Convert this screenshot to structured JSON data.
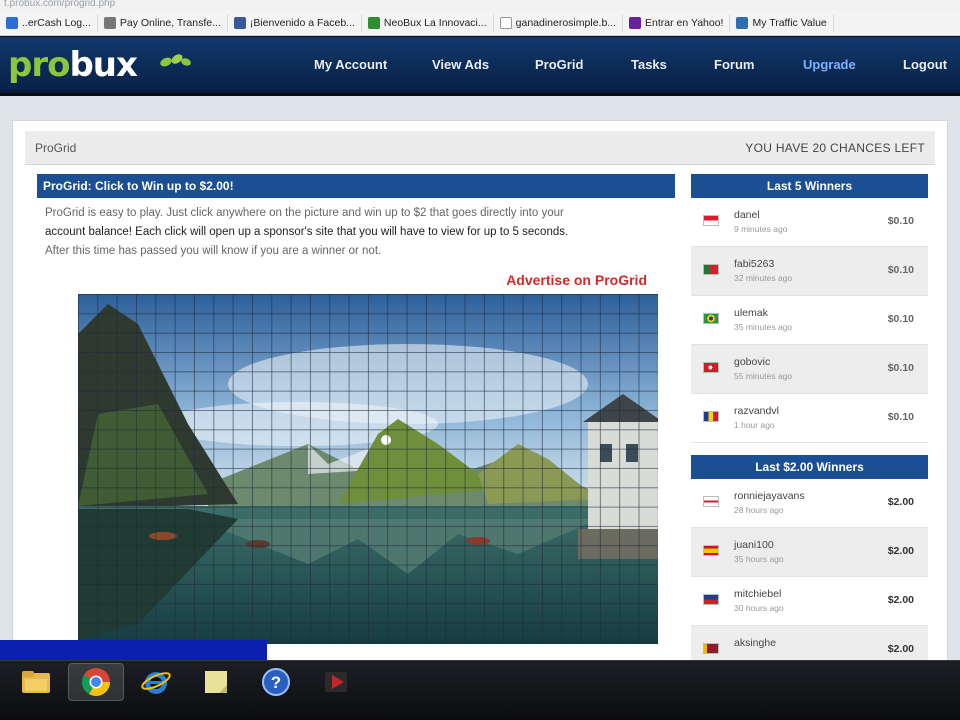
{
  "browser": {
    "address": "t.probux.com/progrid.php",
    "bookmarks": [
      {
        "label": "..erCash Log...",
        "icon": "paycash-icon",
        "color": "#2a6fd6"
      },
      {
        "label": "Pay Online, Transfe...",
        "icon": "pay-online-icon",
        "color": "#5a5a5a"
      },
      {
        "label": "¡Bienvenido a Faceb...",
        "icon": "facebook-icon",
        "color": "#3b5998"
      },
      {
        "label": "NeoBux La Innovaci...",
        "icon": "neobux-icon",
        "color": "#2f8f2f"
      },
      {
        "label": "ganadinerosimple.b...",
        "icon": "page-icon",
        "color": "#666666"
      },
      {
        "label": "Entrar en Yahoo!",
        "icon": "yahoo-icon",
        "color": "#6a1fa0"
      },
      {
        "label": "My Traffic Value",
        "icon": "traffic-value-icon",
        "color": "#2f6db5"
      }
    ]
  },
  "header": {
    "logo_pro": "pro",
    "logo_bux": "bux",
    "nav": [
      "My Account",
      "View Ads",
      "ProGrid",
      "Tasks",
      "Forum",
      "Upgrade",
      "Logout"
    ]
  },
  "page": {
    "section_title": "ProGrid",
    "chances": "YOU HAVE 20 CHANCES LEFT",
    "main": {
      "bar_title": "ProGrid: Click to Win up to $2.00!",
      "intro_1": "ProGrid is easy to play. Just click anywhere on the picture and win up to $2 that goes directly into your",
      "intro_2": "account balance! Each click will open up a sponsor's site that you will have to view for up to 5 seconds.",
      "intro_3": "After this time has passed you will know if you are a winner or not.",
      "advertise": "Advertise on ProGrid"
    },
    "last5": {
      "title": "Last 5 Winners",
      "winners": [
        {
          "name": "danel",
          "time": "9 minutes ago",
          "amount": "$0.10",
          "flag": "id"
        },
        {
          "name": "fabi5263",
          "time": "32 minutes ago",
          "amount": "$0.10",
          "flag": "pt"
        },
        {
          "name": "ulemak",
          "time": "35 minutes ago",
          "amount": "$0.10",
          "flag": "br"
        },
        {
          "name": "gobovic",
          "time": "55 minutes ago",
          "amount": "$0.10",
          "flag": "tr"
        },
        {
          "name": "razvandvl",
          "time": "1 hour ago",
          "amount": "$0.10",
          "flag": "ro"
        }
      ]
    },
    "last200": {
      "title": "Last $2.00 Winners",
      "winners": [
        {
          "name": "ronniejayavans",
          "time": "28 hours ago",
          "amount": "$2.00",
          "flag": "gb"
        },
        {
          "name": "juani100",
          "time": "35 hours ago",
          "amount": "$2.00",
          "flag": "es"
        },
        {
          "name": "mitchiebel",
          "time": "30 hours ago",
          "amount": "$2.00",
          "flag": "ph"
        },
        {
          "name": "aksinghe",
          "time": "",
          "amount": "$2.00",
          "flag": "lk"
        }
      ]
    }
  },
  "taskbar": {
    "icons": [
      "file-explorer-icon",
      "chrome-icon",
      "internet-explorer-icon",
      "sticky-notes-icon",
      "help-icon",
      "media-app-icon"
    ]
  }
}
